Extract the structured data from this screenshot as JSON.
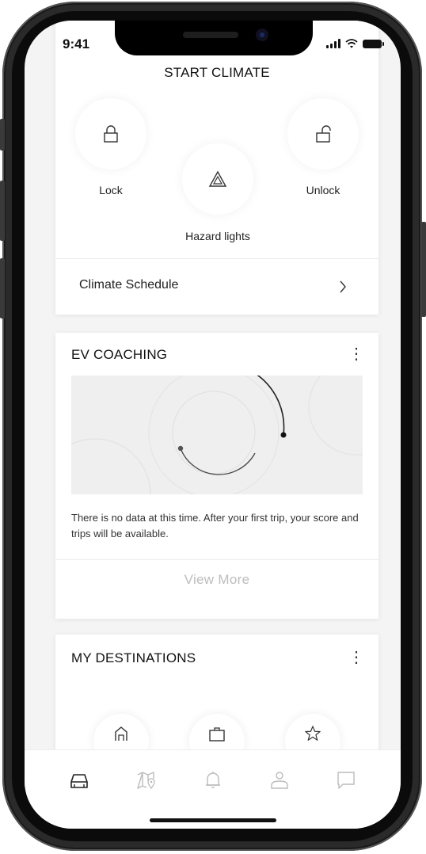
{
  "status": {
    "time": "9:41"
  },
  "climate": {
    "title": "START CLIMATE",
    "lock_label": "Lock",
    "hazard_label": "Hazard lights",
    "unlock_label": "Unlock",
    "schedule_label": "Climate Schedule",
    "chevron": "›"
  },
  "ev": {
    "title": "EV COACHING",
    "menu": "⋮",
    "message": "There is no data at this time. After your first trip, your score and trips will be available.",
    "view_more": "View More"
  },
  "destinations": {
    "title": "MY DESTINATIONS",
    "menu": "⋮",
    "icons": [
      "home-icon",
      "briefcase-icon",
      "star-icon"
    ]
  },
  "tabbar": {
    "items": [
      "car-icon",
      "map-icon",
      "bell-icon",
      "profile-icon",
      "chat-icon"
    ],
    "active": "car-icon"
  }
}
